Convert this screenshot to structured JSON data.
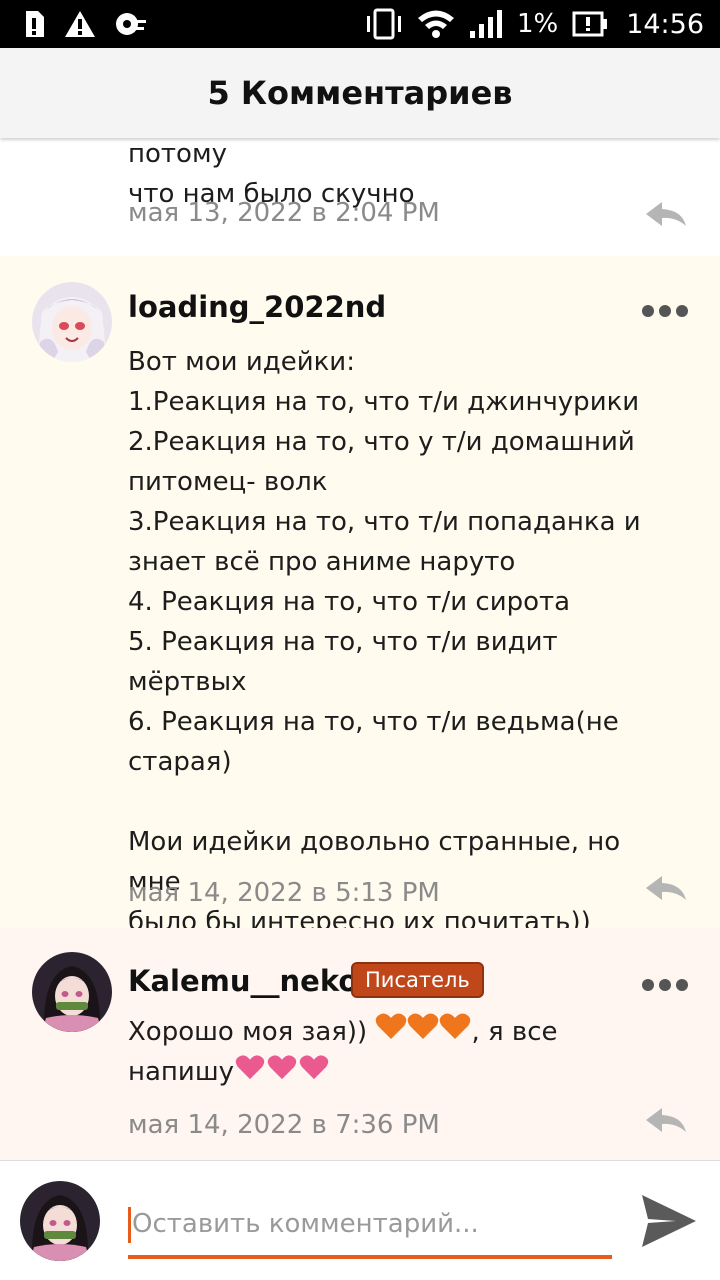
{
  "status_bar": {
    "battery_percent": "1%",
    "time": "14:56"
  },
  "header": {
    "title": "5 Комментариев"
  },
  "comments": [
    {
      "body_visible": "мы с подкой смотрели почтал,,,, потому\nчто нам было скучно",
      "date": "мая 13, 2022 в 2:04 PM"
    },
    {
      "author": "loading_2022nd",
      "body": "Вот мои идейки:\n1.Реакция на то, что т/и джинчурики\n2.Реакция на то, что у т/и домашний\nпитомец- волк\n3.Реакция на то, что т/и попаданка и\nзнает всё про аниме наруто\n4. Реакция на то, что т/и сирота\n5. Реакция на то, что т/и видит мёртвых\n6. Реакция на то, что т/и ведьма(не\nстарая)\n\nМои идейки довольно странные, но мне\nбыло бы интересно их почитать))",
      "date": "мая 14, 2022 в 5:13 PM"
    },
    {
      "author": "Kalemu__neko",
      "badge": "Писатель",
      "body_line1": "Хорошо моя зая)) ",
      "body_line1_end": ", я все",
      "body_line2": "напишу",
      "date": "мая 14, 2022 в 7:36 PM"
    }
  ],
  "input": {
    "placeholder": "Оставить комментарий..."
  },
  "colors": {
    "accent": "#e65c1c",
    "badge": "#c0471a",
    "highlight_bg": "#fffbee",
    "reply_bg": "#fff6f2"
  }
}
